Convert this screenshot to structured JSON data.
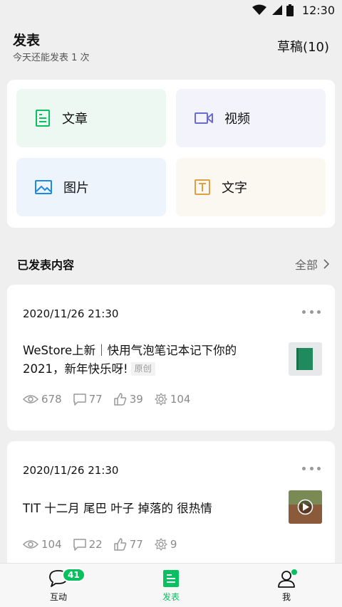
{
  "status_bar": {
    "time": "12:30"
  },
  "header": {
    "title": "发表",
    "subtitle": "今天还能发表 1 次",
    "drafts": "草稿(10)"
  },
  "publish_options": [
    {
      "label": "文章",
      "icon": "article-icon",
      "color": "#07c160"
    },
    {
      "label": "视频",
      "icon": "video-icon",
      "color": "#6b6bd6"
    },
    {
      "label": "图片",
      "icon": "image-icon",
      "color": "#1e88e5"
    },
    {
      "label": "文字",
      "icon": "text-icon",
      "color": "#e0a040"
    }
  ],
  "published": {
    "title": "已发表内容",
    "all_label": "全部"
  },
  "posts": [
    {
      "date": "2020/11/26 21:30",
      "text": "WeStore上新｜快用气泡笔记本记下你的2021，新年快乐呀!",
      "tag": "原创",
      "views": "678",
      "comments": "77",
      "likes": "39",
      "shares": "104"
    },
    {
      "date": "2020/11/26 21:30",
      "text": "TIT 十二月 尾巴 叶子 掉落的 很热情",
      "tag": "",
      "views": "104",
      "comments": "22",
      "likes": "77",
      "shares": "9"
    }
  ],
  "tabbar": {
    "interact_label": "互动",
    "interact_badge": "41",
    "publish_label": "发表",
    "me_label": "我",
    "active_color": "#07c160"
  }
}
